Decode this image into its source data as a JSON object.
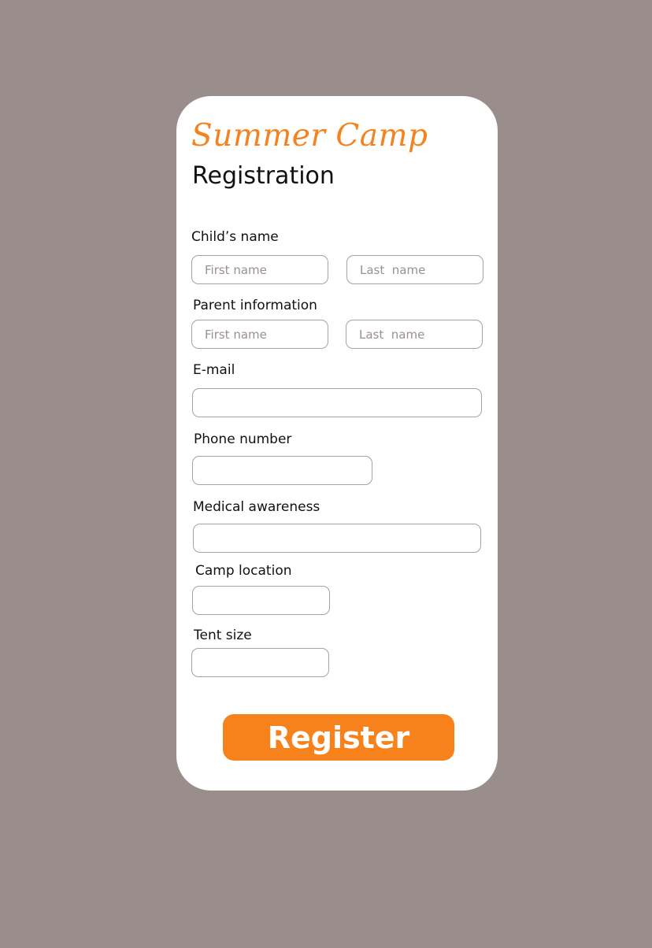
{
  "header": {
    "title": "Summer Camp",
    "subtitle": "Registration"
  },
  "form": {
    "child_name": {
      "label": "Child’s name",
      "first_placeholder": "First name",
      "last_placeholder": "Last  name"
    },
    "parent": {
      "label": "Parent information",
      "first_placeholder": "First name",
      "last_placeholder": "Last  name"
    },
    "email": {
      "label": "E-mail",
      "value": ""
    },
    "phone": {
      "label": "Phone number",
      "value": ""
    },
    "medical": {
      "label": "Medical awareness",
      "value": ""
    },
    "camp_location": {
      "label": "Camp location",
      "value": ""
    },
    "tent_size": {
      "label": "Tent size",
      "value": ""
    },
    "submit_label": "Register"
  },
  "colors": {
    "background": "#9a8e8d",
    "card": "#ffffff",
    "accent": "#f7821b"
  }
}
